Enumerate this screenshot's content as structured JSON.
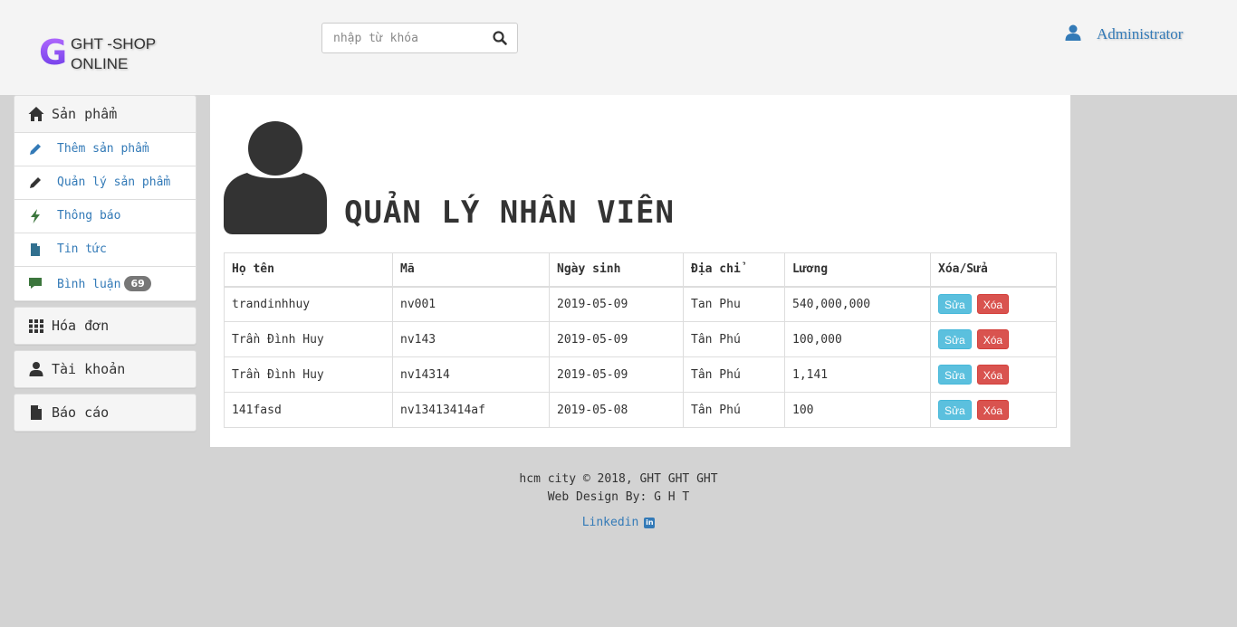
{
  "brand": {
    "letter": "G",
    "line1": "GHT -SHOP",
    "line2": "ONLINE"
  },
  "search": {
    "placeholder": "nhập từ khóa",
    "value": ""
  },
  "user": {
    "name": "Administrator"
  },
  "sidebar": {
    "products": {
      "label": "Sản phẩm",
      "items": [
        {
          "label": "Thêm sản phẩm",
          "icon": "pencil-icon",
          "color": "#337ab7"
        },
        {
          "label": "Quản lý sản phẩm",
          "icon": "pencil-icon",
          "color": "#333333"
        },
        {
          "label": "Thông báo",
          "icon": "flash-icon",
          "color": "#3c763d"
        },
        {
          "label": "Tin tức",
          "icon": "file-icon",
          "color": "#31708f"
        },
        {
          "label": "Bình luận",
          "icon": "comment-icon",
          "color": "#3c763d",
          "badge": "69"
        }
      ]
    },
    "invoices": {
      "label": "Hóa đơn"
    },
    "accounts": {
      "label": "Tài khoản"
    },
    "reports": {
      "label": "Báo cáo"
    }
  },
  "page": {
    "title": "QUẢN LÝ NHÂN VIÊN"
  },
  "table": {
    "columns": [
      "Họ tên",
      "Mã",
      "Ngày sinh",
      "Địa chỉ",
      "Lương",
      "Xóa/Sửa"
    ],
    "rows": [
      [
        "trandinhhuy",
        "nv001",
        "2019-05-09",
        "Tan Phu",
        "540,000,000"
      ],
      [
        "Trần Đình Huy",
        "nv143",
        "2019-05-09",
        "Tân Phú",
        "100,000"
      ],
      [
        "Trần Đình Huy",
        "nv14314",
        "2019-05-09",
        "Tân Phú",
        "1,141"
      ],
      [
        "141fasd",
        "nv13413414af",
        "2019-05-08",
        "Tân Phú",
        "100"
      ]
    ],
    "edit_label": "Sửa",
    "delete_label": "Xóa"
  },
  "footer": {
    "line1": "hcm city © 2018, GHT GHT GHT",
    "line2": "Web Design By: G H T",
    "link": "Linkedin"
  },
  "colors": {
    "header_bg": "#f4f4f4",
    "body_bg": "#d3d3d3",
    "link": "#337ab7",
    "edit": "#5bc0de",
    "delete": "#d9534f"
  }
}
